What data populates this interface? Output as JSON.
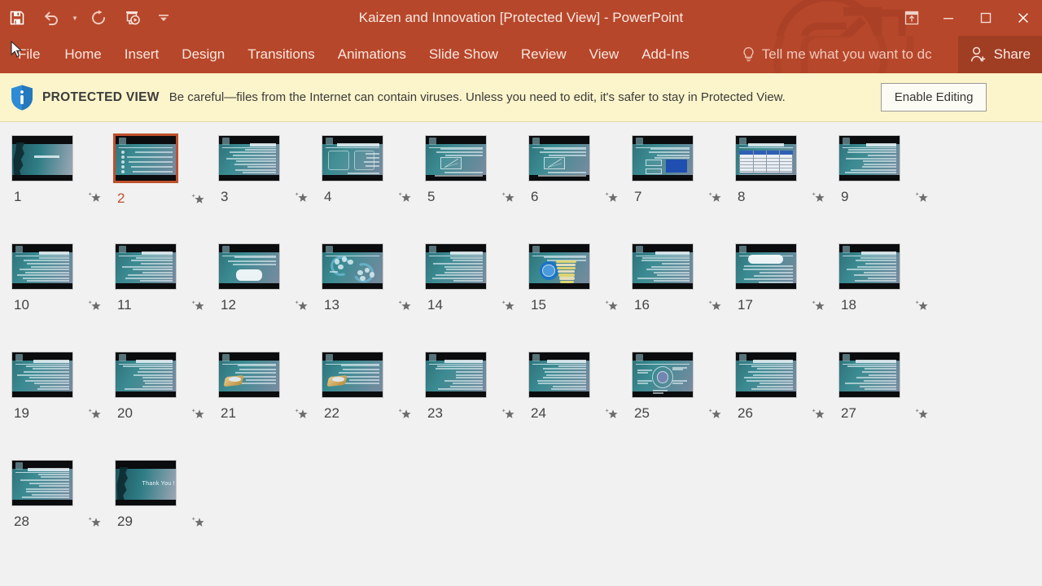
{
  "window": {
    "title": "Kaizen and Innovation [Protected View] - PowerPoint",
    "quick_access": [
      {
        "name": "save",
        "icon": "save-icon",
        "label": "Save"
      },
      {
        "name": "undo",
        "icon": "undo-icon",
        "label": "Undo"
      },
      {
        "name": "redo",
        "icon": "redo-icon",
        "label": "Redo"
      },
      {
        "name": "start-slideshow",
        "icon": "slideshow-icon",
        "label": "Start From Beginning"
      },
      {
        "name": "customize",
        "icon": "chevron-down-icon",
        "label": "Customize Quick Access Toolbar"
      }
    ],
    "controls": [
      {
        "name": "ribbon-display-options",
        "icon": "ribbon-options-icon",
        "label": "Ribbon Display Options"
      },
      {
        "name": "minimize",
        "icon": "minimize-icon",
        "label": "Minimize"
      },
      {
        "name": "maximize",
        "icon": "maximize-icon",
        "label": "Restore Down"
      },
      {
        "name": "close",
        "icon": "close-icon",
        "label": "Close"
      }
    ],
    "accent_color": "#b7472a",
    "share_bg_color": "#a03e24"
  },
  "ribbon": {
    "tabs": [
      {
        "label": "File"
      },
      {
        "label": "Home"
      },
      {
        "label": "Insert"
      },
      {
        "label": "Design"
      },
      {
        "label": "Transitions"
      },
      {
        "label": "Animations"
      },
      {
        "label": "Slide Show"
      },
      {
        "label": "Review"
      },
      {
        "label": "View"
      },
      {
        "label": "Add-Ins"
      }
    ],
    "tellme_placeholder": "Tell me what you want to dc",
    "share_label": "Share"
  },
  "protected_view": {
    "badge": "PROTECTED VIEW",
    "message": "Be careful—files from the Internet can contain viruses. Unless you need to edit, it's safer to stay in Protected View.",
    "button": "Enable Editing",
    "bar_color": "#fcf4ca",
    "shield_color": "#2e8bd6"
  },
  "slides": [
    {
      "number": "1",
      "kind": "cover",
      "selected": false
    },
    {
      "number": "2",
      "kind": "agenda",
      "selected": true
    },
    {
      "number": "3",
      "kind": "text",
      "selected": false
    },
    {
      "number": "4",
      "kind": "twobox",
      "selected": false
    },
    {
      "number": "5",
      "kind": "chart",
      "selected": false
    },
    {
      "number": "6",
      "kind": "chart",
      "selected": false
    },
    {
      "number": "7",
      "kind": "chartblue",
      "selected": false
    },
    {
      "number": "8",
      "kind": "table",
      "selected": false
    },
    {
      "number": "9",
      "kind": "text",
      "selected": false
    },
    {
      "number": "10",
      "kind": "text",
      "selected": false
    },
    {
      "number": "11",
      "kind": "text",
      "selected": false
    },
    {
      "number": "12",
      "kind": "callout",
      "selected": false
    },
    {
      "number": "13",
      "kind": "cycle",
      "selected": false
    },
    {
      "number": "14",
      "kind": "text",
      "selected": false
    },
    {
      "number": "15",
      "kind": "circlelist",
      "selected": false
    },
    {
      "number": "16",
      "kind": "text",
      "selected": false
    },
    {
      "number": "17",
      "kind": "pill",
      "selected": false
    },
    {
      "number": "18",
      "kind": "text",
      "selected": false
    },
    {
      "number": "19",
      "kind": "text",
      "selected": false
    },
    {
      "number": "20",
      "kind": "text",
      "selected": false
    },
    {
      "number": "21",
      "kind": "gold",
      "selected": false
    },
    {
      "number": "22",
      "kind": "gold",
      "selected": false
    },
    {
      "number": "23",
      "kind": "text",
      "selected": false
    },
    {
      "number": "24",
      "kind": "text",
      "selected": false
    },
    {
      "number": "25",
      "kind": "radial",
      "selected": false
    },
    {
      "number": "26",
      "kind": "text",
      "selected": false
    },
    {
      "number": "27",
      "kind": "text",
      "selected": false
    },
    {
      "number": "28",
      "kind": "text",
      "selected": false
    },
    {
      "number": "29",
      "kind": "thankyou",
      "selected": false,
      "caption": "Thank You !"
    }
  ],
  "icons": {
    "star": "star-icon"
  }
}
